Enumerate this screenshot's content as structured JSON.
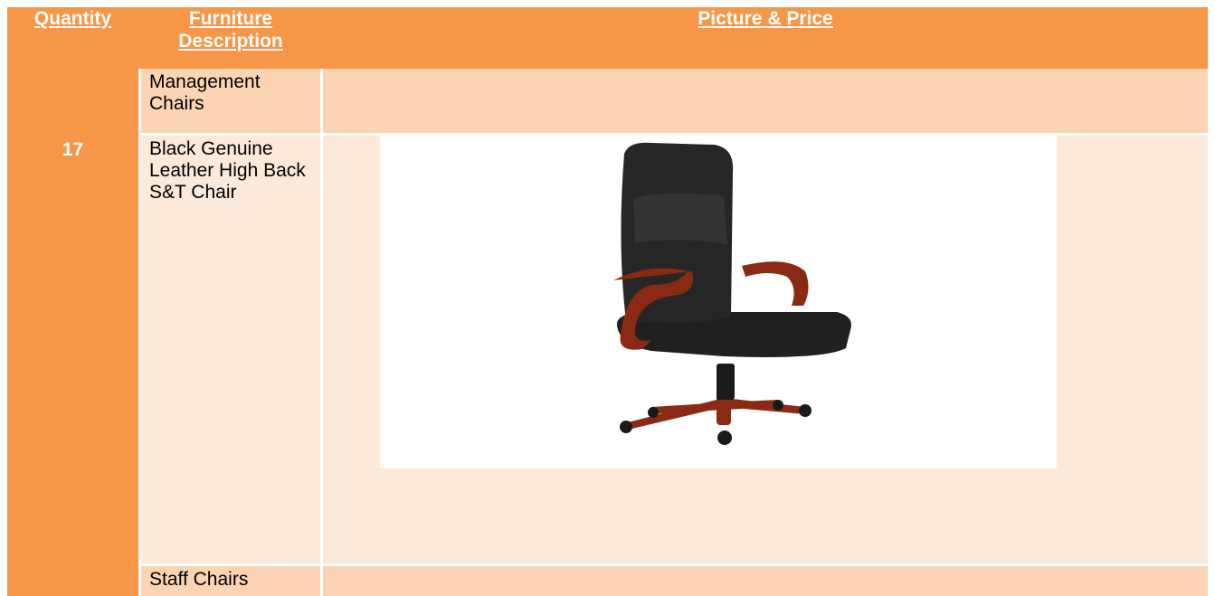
{
  "header": {
    "quantity_label": "Quantity",
    "description_label": "Furniture Description",
    "picture_label": "Picture & Price"
  },
  "quantity": "17",
  "rows": [
    {
      "description": "Management Chairs"
    },
    {
      "description": "Black Genuine Leather High Back S&T Chair",
      "picture": "office-chair-image"
    },
    {
      "description": "Staff Chairs"
    }
  ],
  "colors": {
    "header": "#f79646",
    "row_dark": "#fbd4b4",
    "row_light": "#fde9d9",
    "header_text": "#ffffff"
  }
}
